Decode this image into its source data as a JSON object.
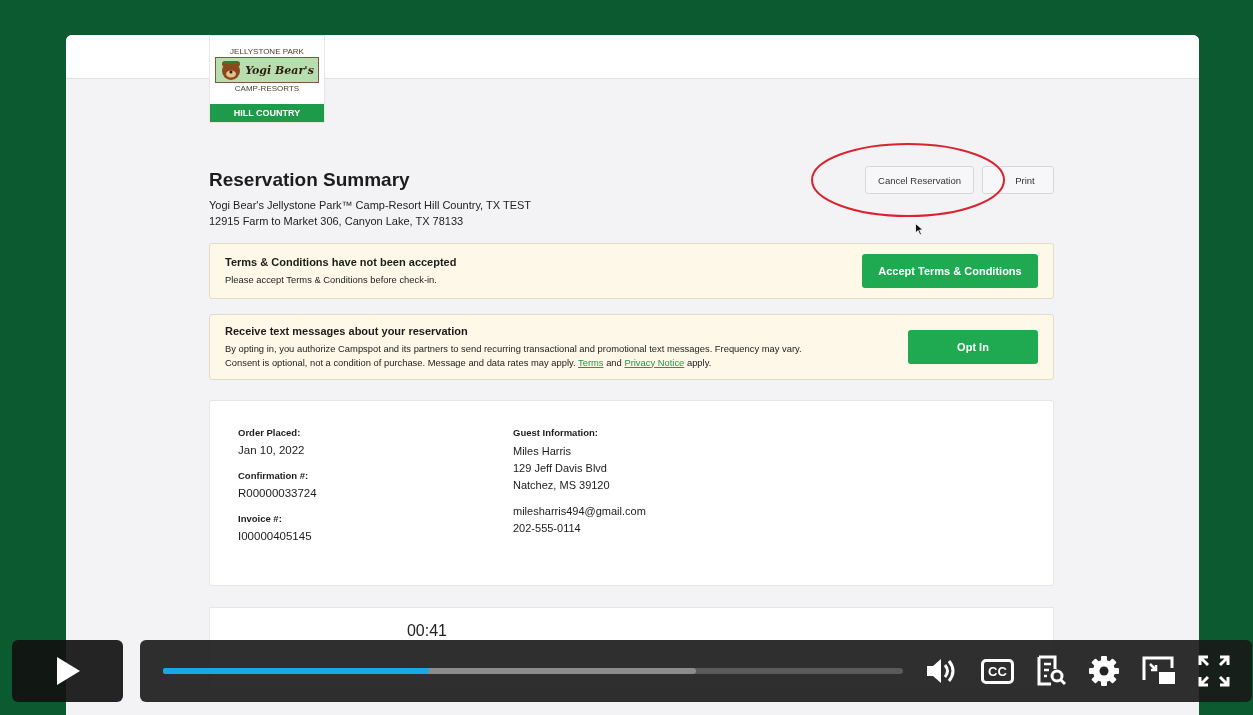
{
  "logo": {
    "top": "JELLYSTONE PARK",
    "script": "Yogi Bear's",
    "bottom": "CAMP-RESORTS",
    "band": "HILL COUNTRY"
  },
  "title": "Reservation Summary",
  "actions": [
    {
      "label": "Cancel Reservation"
    },
    {
      "label": "Print"
    }
  ],
  "park_name": "Yogi Bear's Jellystone Park™ Camp-Resort Hill Country, TX TEST",
  "park_address": "12915 Farm to Market 306, Canyon Lake, TX 78133",
  "banners": [
    {
      "title": "Terms & Conditions have not been accepted",
      "segments": [
        {
          "text": "Please accept Terms & Conditions before check-in.",
          "link": false
        }
      ],
      "button": "Accept Terms & Conditions"
    },
    {
      "title": "Receive text messages about your reservation",
      "segments": [
        {
          "text": "By opting in, you authorize Campspot and its partners to send recurring transactional and promotional text messages. Frequency may vary. Consent is optional, not a condition of purchase. Message and data rates may apply. ",
          "link": false
        },
        {
          "text": "Terms",
          "link": true
        },
        {
          "text": " and ",
          "link": false
        },
        {
          "text": "Privacy Notice",
          "link": true
        },
        {
          "text": " apply.",
          "link": false
        }
      ],
      "button": "Opt In"
    }
  ],
  "order": [
    {
      "label": "Order Placed:",
      "value": "Jan 10, 2022"
    },
    {
      "label": "Confirmation #:",
      "value": "R00000033724"
    },
    {
      "label": "Invoice #:",
      "value": "I00000405145"
    }
  ],
  "guest": {
    "label": "Guest Information:",
    "address": [
      "Miles Harris",
      "129 Jeff Davis Blvd",
      "Natchez, MS 39120"
    ],
    "contact": [
      "milesharris494@gmail.com",
      "202-555-0114"
    ]
  },
  "player": {
    "time": "00:41",
    "progress": {
      "level": 0.36
    },
    "buffered": {
      "level": 0.72
    },
    "cc": "CC"
  }
}
